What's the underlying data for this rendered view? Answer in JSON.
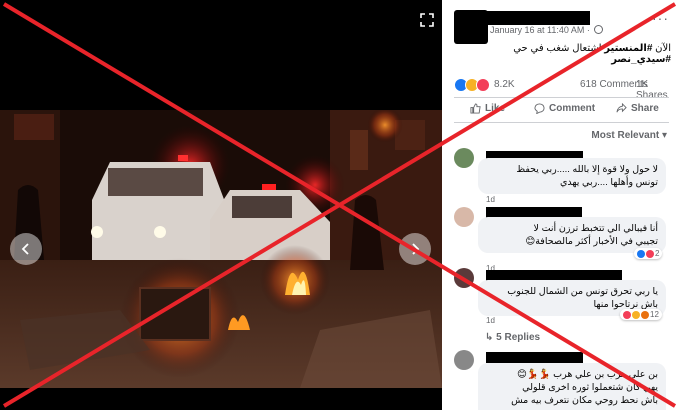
{
  "post": {
    "date": "January 16 at 11:40 AM",
    "date_separator": "·",
    "more_label": "···",
    "text_plain": "الآن ",
    "hashtag_1": "#المنستير",
    "text_middle": " اشتعال شغب في حي ",
    "hashtag_2": "#سيدي_نصر"
  },
  "stats": {
    "reactions": "8.2K",
    "comments": "618 Comments",
    "shares": "1K Shares"
  },
  "actions": {
    "like": "Like",
    "comment": "Comment",
    "share": "Share"
  },
  "sort_label": "Most Relevant",
  "comments": [
    {
      "line1": "لا حول ولا قوة إلا بالله .....ربي يحفظ",
      "line2": "تونس وأهلها ....ربي يهدي",
      "time": "1d"
    },
    {
      "line1": "أنا فيبالي الي تتخبط ترزن أنت لا",
      "line2": "تجيبي في الأخبار أكثر مالصحافة😊",
      "time": "1d",
      "reaction_count": "2"
    },
    {
      "line1": "يا ربي تحرق تونس من الشمال للجنوب",
      "line2": "باش نرتاحوا منها",
      "time": "1d",
      "reaction_count": "12"
    },
    {
      "line1": "بن علي هرب بن علي هرب 💃💃😊",
      "line2": "يهي كان شتعملوا ثوره اخرى قلولي",
      "line3": "باش نحط روحي مكان نتعرف بيه مش",
      "time": ""
    }
  ],
  "replies_label": "5 Replies",
  "colors": {
    "cross": "#e8242a",
    "fb_gray": "#65676b",
    "bubble": "#f0f2f5",
    "like_blue": "#1877f2",
    "love_red": "#f33e58",
    "haha_yellow": "#f7b125"
  },
  "icons": [
    "expand-icon",
    "chevron-left-icon",
    "chevron-right-icon",
    "globe-icon",
    "like-icon",
    "comment-icon",
    "share-icon"
  ]
}
